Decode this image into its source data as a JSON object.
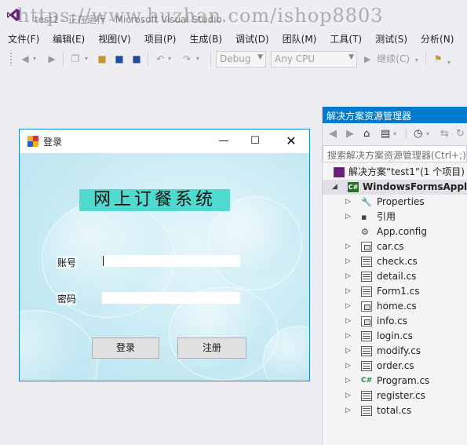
{
  "vs": {
    "title": "test1 - 正在运行 - Microsoft Visual Studio",
    "watermark": "https://www.huzhan.com/ishop8803",
    "menu": [
      "文件(F)",
      "编辑(E)",
      "视图(V)",
      "项目(P)",
      "生成(B)",
      "调试(D)",
      "团队(M)",
      "工具(T)",
      "测试(S)",
      "分析(N)"
    ],
    "toolbar": {
      "config": "Debug",
      "platform": "Any CPU",
      "continue_label": "继续(C)"
    }
  },
  "solution_explorer": {
    "title": "解决方案资源管理器",
    "search_placeholder": "搜索解决方案资源管理器(Ctrl+;)",
    "solution_label": "解决方案“test1”(1 个项目)",
    "project_label": "WindowsFormsApplic",
    "items": [
      {
        "label": "Properties",
        "icon": "wrench-icon",
        "expandable": true
      },
      {
        "label": "引用",
        "icon": "references-icon",
        "expandable": true
      },
      {
        "label": "App.config",
        "icon": "config-icon",
        "expandable": false
      },
      {
        "label": "car.cs",
        "icon": "class-file-icon",
        "expandable": true
      },
      {
        "label": "check.cs",
        "icon": "form-file-icon",
        "expandable": true
      },
      {
        "label": "detail.cs",
        "icon": "form-file-icon",
        "expandable": true
      },
      {
        "label": "Form1.cs",
        "icon": "form-file-icon",
        "expandable": true
      },
      {
        "label": "home.cs",
        "icon": "class-file-icon",
        "expandable": true
      },
      {
        "label": "info.cs",
        "icon": "class-file-icon",
        "expandable": true
      },
      {
        "label": "login.cs",
        "icon": "form-file-icon",
        "expandable": true
      },
      {
        "label": "modify.cs",
        "icon": "form-file-icon",
        "expandable": true
      },
      {
        "label": "order.cs",
        "icon": "form-file-icon",
        "expandable": true
      },
      {
        "label": "Program.cs",
        "icon": "csharp-file-icon",
        "expandable": true
      },
      {
        "label": "register.cs",
        "icon": "form-file-icon",
        "expandable": true
      },
      {
        "label": "total.cs",
        "icon": "form-file-icon",
        "expandable": true
      }
    ]
  },
  "login_form": {
    "window_title": "登录",
    "system_title": "网上订餐系统",
    "account_label": "账号",
    "password_label": "密码",
    "account_value": "",
    "password_value": "",
    "login_button": "登录",
    "register_button": "注册"
  },
  "colors": {
    "vs_accent": "#007acc",
    "title_highlight": "#4fd9cf",
    "form_border": "#1883d7"
  }
}
